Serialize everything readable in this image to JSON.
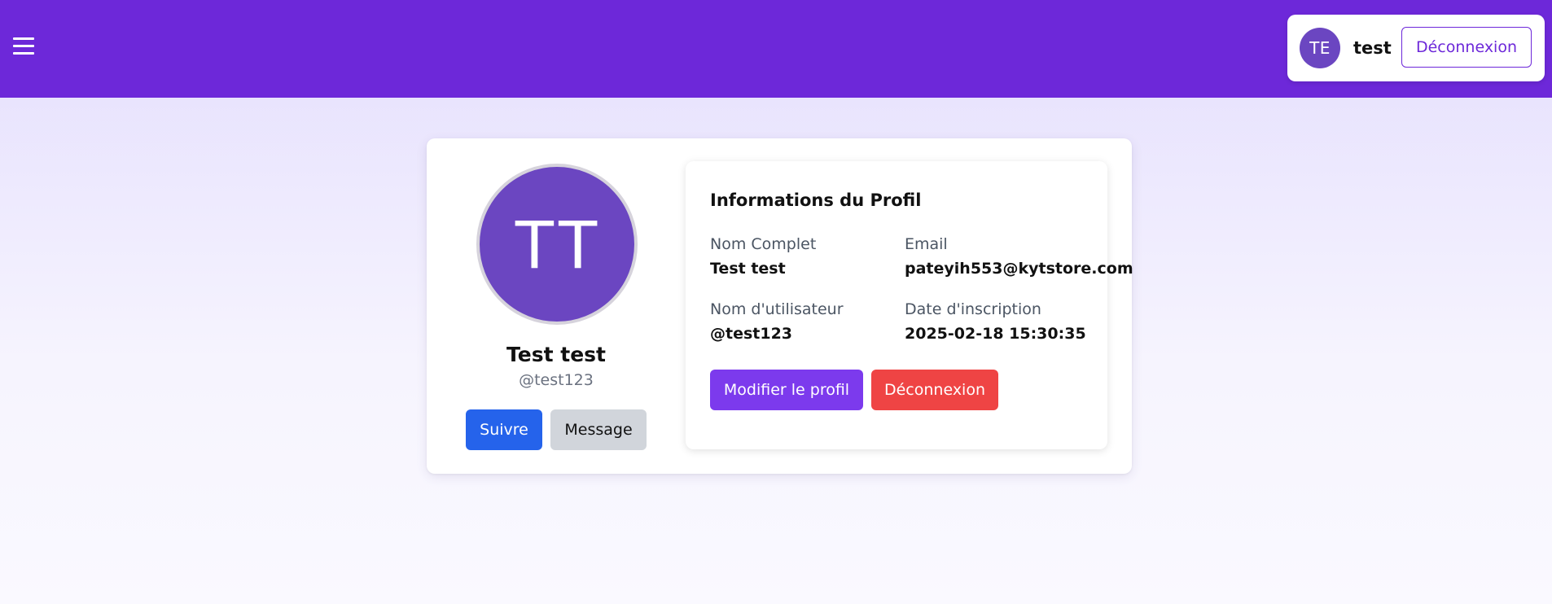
{
  "header": {
    "menu_icon": "hamburger-menu-icon",
    "user": {
      "initials": "TE",
      "name": "test",
      "logout_label": "Déconnexion"
    }
  },
  "profile": {
    "initials": "TT",
    "full_name": "Test test",
    "username": "@test123",
    "follow_label": "Suivre",
    "message_label": "Message"
  },
  "info": {
    "title": "Informations du Profil",
    "fields": [
      {
        "label": "Nom Complet",
        "value": "Test test"
      },
      {
        "label": "Email",
        "value": "pateyih553@kytstore.com"
      },
      {
        "label": "Nom d'utilisateur",
        "value": "@test123"
      },
      {
        "label": "Date d'inscription",
        "value": "2025-02-18 15:30:35"
      }
    ],
    "edit_label": "Modifier le profil",
    "logout_label": "Déconnexion"
  },
  "colors": {
    "navbar": "#6d28d9",
    "avatar": "#6b46c1",
    "follow": "#2563eb",
    "message": "#d1d5db",
    "edit": "#7c3aed",
    "logout": "#ef4444"
  }
}
